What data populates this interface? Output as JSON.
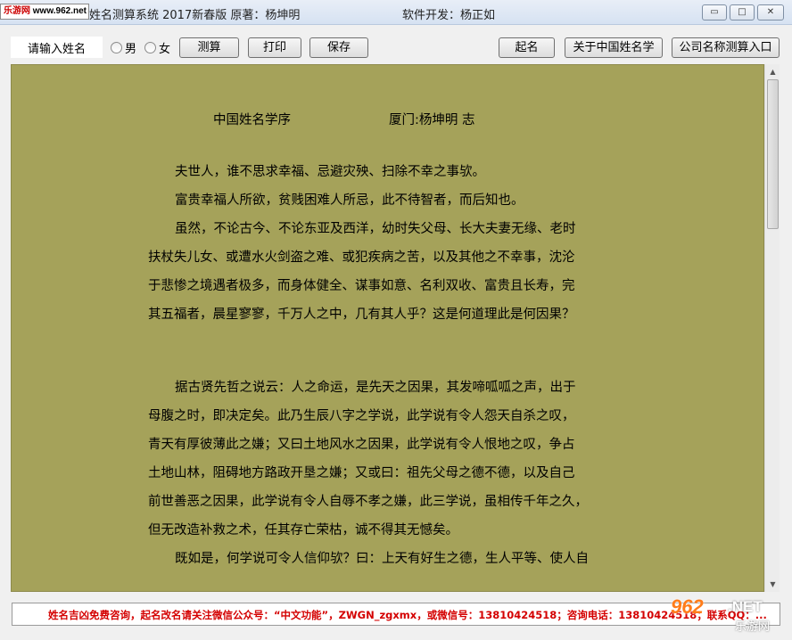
{
  "window": {
    "logo_badge": {
      "site_cn": "乐游网",
      "site_url": "www.962.net"
    },
    "title": "姓名测算系统 2017新春版  原著：杨坤明",
    "developer": "软件开发：杨正如",
    "controls": {
      "minimize": "▭",
      "maximize": "□",
      "close": "✕"
    }
  },
  "toolbar": {
    "name_input": {
      "value": "请输入姓名",
      "placeholder": "请输入姓名"
    },
    "gender": {
      "male": "男",
      "female": "女",
      "selected": ""
    },
    "buttons": {
      "calculate": "测算",
      "print": "打印",
      "save": "保存",
      "naming": "起名",
      "about": "关于中国姓名学",
      "company": "公司名称测算入口"
    }
  },
  "document": {
    "title": "中国姓名学序",
    "author": "厦门:杨坤明 志",
    "paragraph1": [
      "夫世人，谁不思求幸福、忌避灾殃、扫除不幸之事欤。",
      "富贵幸福人所欲，贫贱困难人所忌，此不待智者，而后知也。",
      "虽然，不论古今、不论东亚及西洋，幼时失父母、长大夫妻无缘、老时",
      "扶杖失儿女、或遭水火剑盗之难、或犯疾病之苦，以及其他之不幸事，沈沦",
      "于悲惨之境遇者极多，而身体健全、谋事如意、名利双收、富贵且长寿，完",
      "其五福者，晨星寥寥，千万人之中，几有其人乎？这是何道理此是何因果？"
    ],
    "paragraph2": [
      "据古贤先哲之说云：人之命运，是先天之因果，其发啼呱呱之声，出于",
      "母腹之时，即决定矣。此乃生辰八字之学说，此学说有令人怨天自杀之叹，",
      "青天有厚彼薄此之嫌；又曰土地风水之因果，此学说有令人恨地之叹，争占",
      "土地山林，阻碍地方路政开垦之嫌；又或曰：祖先父母之德不德，以及自己",
      "前世善恶之因果，此学说有令人自辱不孝之嫌，此三学说，虽相传千年之久，",
      "但无改造补救之术，任其存亡荣枯，诚不得其无憾矣。",
      "既如是，何学说可令人信仰欤？曰：上天有好生之德，生人平等、使人自"
    ]
  },
  "status_bar": {
    "text": "姓名吉凶免费咨询，起名改名请关注微信公众号：“中文功能”，ZWGN_zgxmx，或微信号：13810424518；咨询电话：13810424518；联系QQ：..."
  },
  "watermark": {
    "mark": "962",
    "net": ".NET",
    "cn": "乐游网"
  },
  "colors": {
    "content_bg": "#a5a25a",
    "status_text": "#d40000",
    "watermark": "#ff7c1a"
  }
}
